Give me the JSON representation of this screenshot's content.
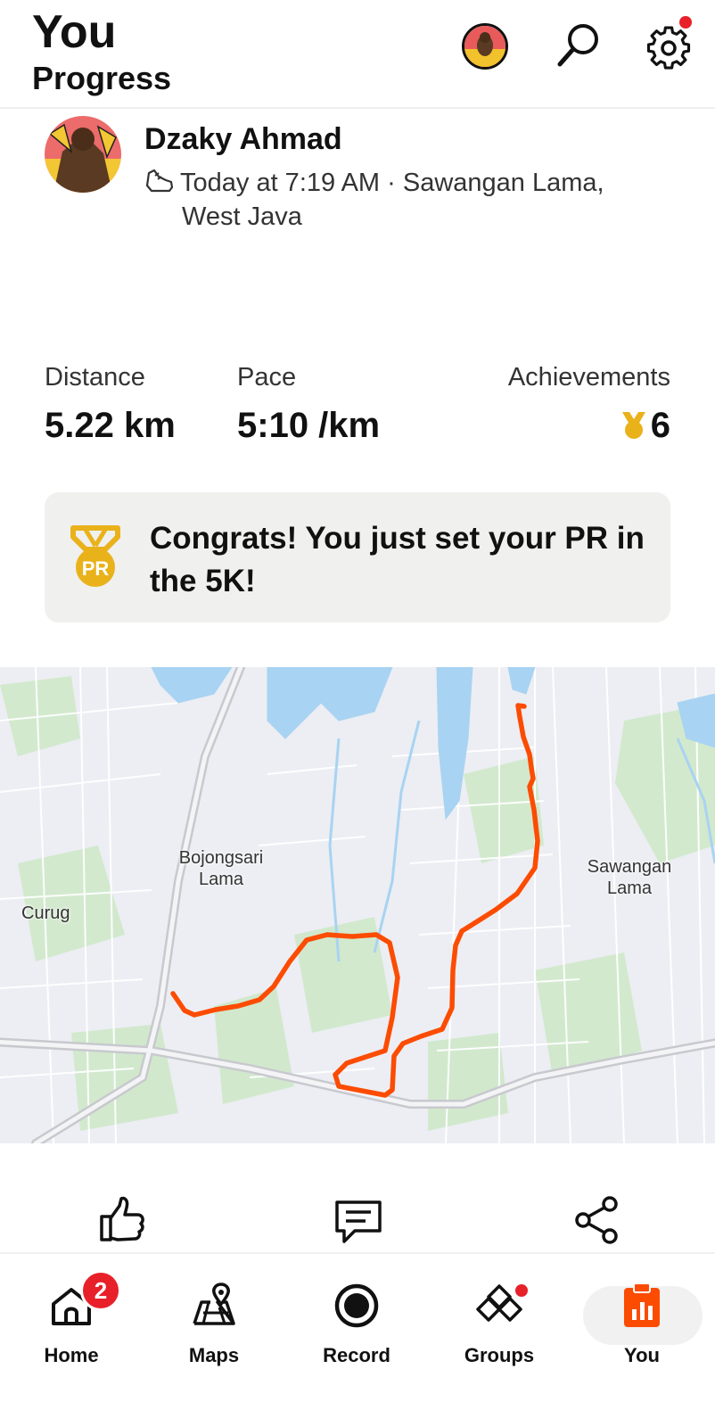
{
  "header": {
    "title": "You",
    "subtitle": "Progress"
  },
  "activity": {
    "athlete_name": "Dzaky Ahmad",
    "time_location_line1": "Today at 7:19 AM · Sawangan Lama,",
    "time_location_line2": "West Java"
  },
  "stats": {
    "distance_label": "Distance",
    "distance_value": "5.22 km",
    "pace_label": "Pace",
    "pace_value": "5:10 /km",
    "achievements_label": "Achievements",
    "achievements_value": "6"
  },
  "pr_card": {
    "text": "Congrats! You just set your PR in the 5K!",
    "badge_text": "PR"
  },
  "map": {
    "labels": {
      "bojongsari": "Bojongsari Lama",
      "curug": "Curug",
      "sawangan": "Sawangan Lama"
    },
    "route_color": "#fc4c02"
  },
  "nav": {
    "items": [
      {
        "label": "Home",
        "icon": "home-icon",
        "badge": "2"
      },
      {
        "label": "Maps",
        "icon": "maps-icon"
      },
      {
        "label": "Record",
        "icon": "record-icon"
      },
      {
        "label": "Groups",
        "icon": "groups-icon"
      },
      {
        "label": "You",
        "icon": "you-icon",
        "active": true
      }
    ]
  },
  "colors": {
    "accent": "#fc4c02",
    "badge_red": "#e8202a",
    "gold": "#e9b21b"
  }
}
